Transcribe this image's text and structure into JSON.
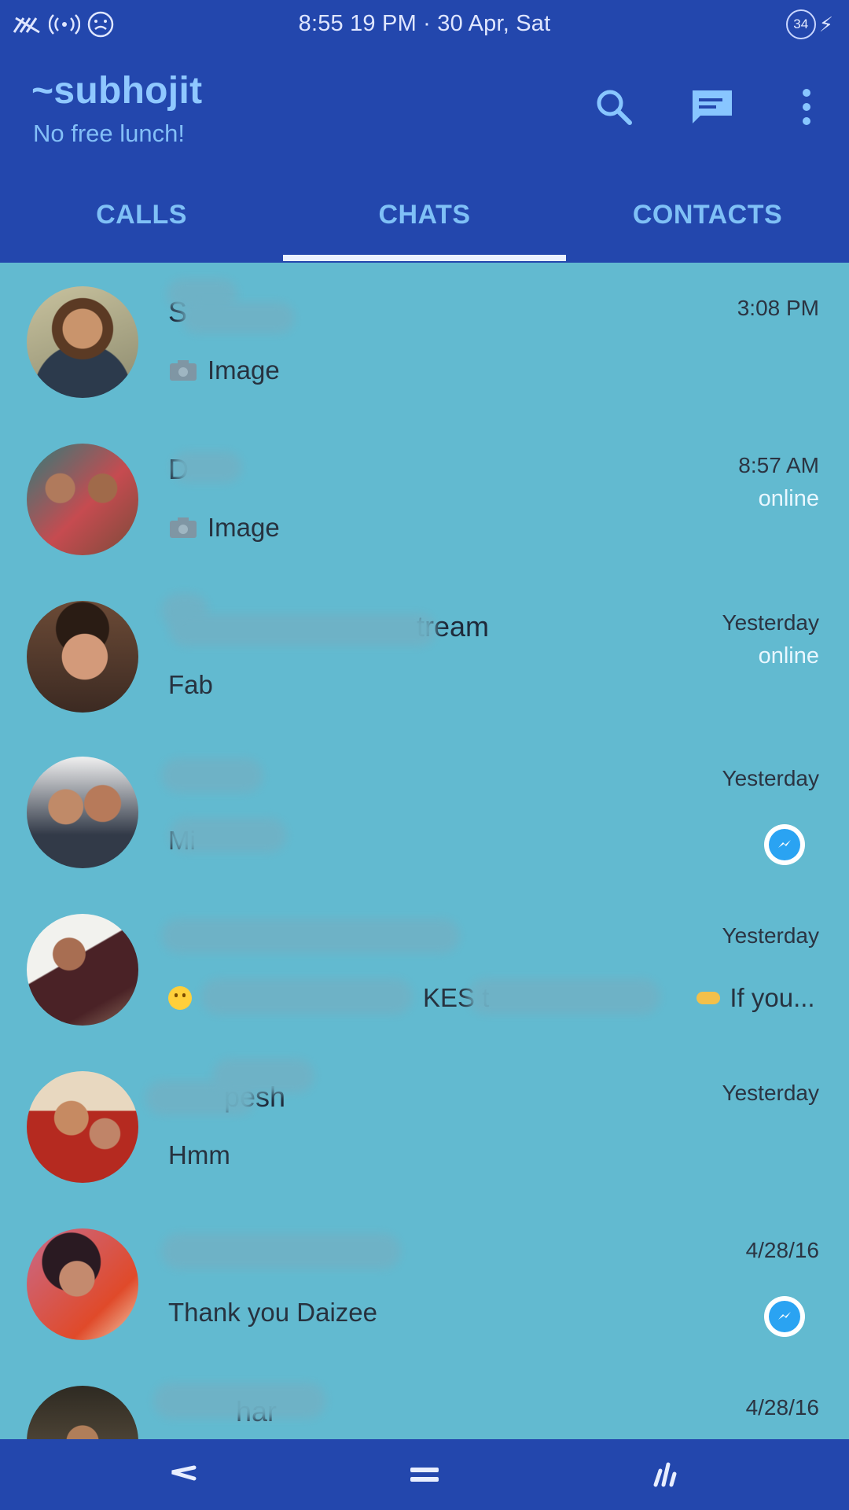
{
  "status_bar": {
    "time_date": "8:55 19 PM · 30 Apr, Sat",
    "battery_level": "34",
    "icons": [
      "no-signal-icon",
      "hotspot-icon",
      "face-icon",
      "battery-icon",
      "charging-icon"
    ]
  },
  "header": {
    "title": "~subhojit",
    "subtitle": "No free lunch!",
    "actions": [
      "search-icon",
      "compose-icon",
      "overflow-menu-icon"
    ]
  },
  "tabs": [
    {
      "label": "CALLS",
      "active": false
    },
    {
      "label": "CHATS",
      "active": true
    },
    {
      "label": "CONTACTS",
      "active": false
    }
  ],
  "chats": [
    {
      "name": "S",
      "preview": "Image",
      "preview_icon": "camera-icon",
      "time": "3:08 PM",
      "online": "",
      "messenger": false
    },
    {
      "name": "D",
      "preview": "Image",
      "preview_icon": "camera-icon",
      "time": "8:57 AM",
      "online": "online",
      "messenger": false
    },
    {
      "name": "tream",
      "preview": "Fab",
      "preview_icon": "",
      "time": "Yesterday",
      "online": "online",
      "messenger": true
    },
    {
      "name": "",
      "preview": "Mi",
      "preview_icon": "",
      "time": "Yesterday",
      "online": "",
      "messenger": true
    },
    {
      "name": "",
      "preview": "KES t",
      "preview_suffix": "If you...",
      "preview_icon": "smiley-icon",
      "time": "Yesterday",
      "online": "",
      "messenger": false
    },
    {
      "name": "pesh",
      "preview": "Hmm",
      "preview_icon": "",
      "time": "Yesterday",
      "online": "",
      "messenger": false
    },
    {
      "name": "",
      "preview": "Thank you Daizee",
      "preview_icon": "",
      "time": "4/28/16",
      "online": "",
      "messenger": true
    },
    {
      "name": "har",
      "preview": "",
      "preview_icon": "",
      "time": "4/28/16",
      "online": "",
      "messenger": false
    }
  ],
  "colors": {
    "header_bg": "#2347ad",
    "list_bg": "#62bad0",
    "tab_text": "#7fc0f6",
    "online_text": "#e9f7ff",
    "messenger_blue": "#2aa3f2"
  },
  "bottom_nav": [
    "back-icon",
    "home-icon",
    "recents-icon"
  ]
}
